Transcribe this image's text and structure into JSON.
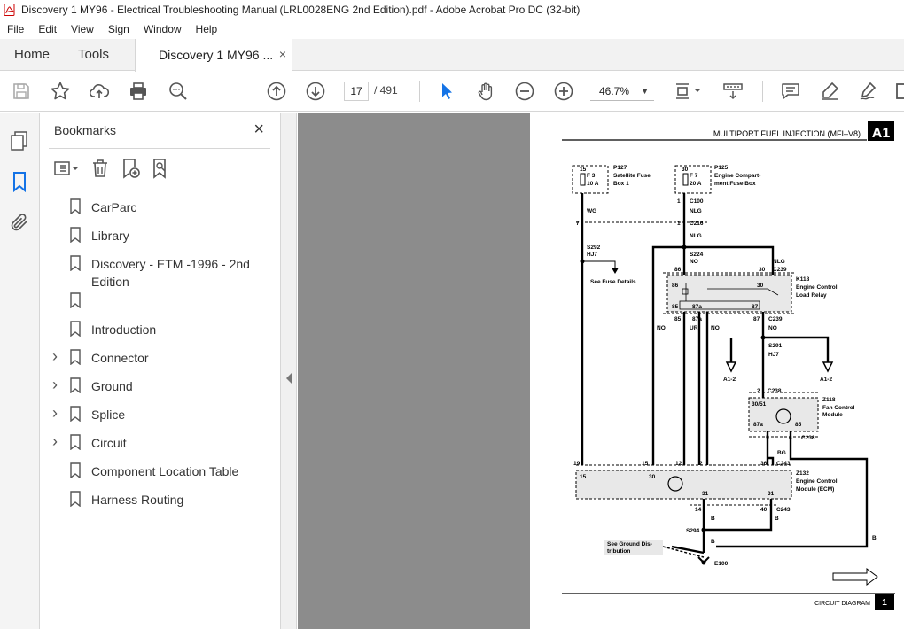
{
  "window": {
    "title": "Discovery 1 MY96 - Electrical Troubleshooting Manual (LRL0028ENG 2nd Edition).pdf - Adobe Acrobat Pro DC (32-bit)"
  },
  "menu": [
    "File",
    "Edit",
    "View",
    "Sign",
    "Window",
    "Help"
  ],
  "tabs": {
    "home": "Home",
    "tools": "Tools",
    "document": "Discovery 1 MY96 ...",
    "close_glyph": "×"
  },
  "toolbar": {
    "current_page": "17",
    "page_total": "/ 491",
    "zoom": "46.7%"
  },
  "bookmarks": {
    "title": "Bookmarks",
    "close_glyph": "×",
    "items": [
      {
        "label": "CarParc",
        "expandable": false
      },
      {
        "label": "Library",
        "expandable": false
      },
      {
        "label": "Discovery - ETM -1996 - 2nd Edition",
        "expandable": false
      },
      {
        "label": "",
        "expandable": false
      },
      {
        "label": "Introduction",
        "expandable": false
      },
      {
        "label": "Connector",
        "expandable": true
      },
      {
        "label": "Ground",
        "expandable": true
      },
      {
        "label": "Splice",
        "expandable": true
      },
      {
        "label": "Circuit",
        "expandable": true
      },
      {
        "label": "Component Location Table",
        "expandable": false
      },
      {
        "label": "Harness Routing",
        "expandable": false
      }
    ]
  },
  "diagram": {
    "header_title": "MULTIPORT FUEL INJECTION (MFI–V8)",
    "header_code": "A1",
    "footer_title": "CIRCUIT DIAGRAM",
    "footer_page": "1",
    "labels": {
      "f3_name": "F 3",
      "f3_rating": "10 A",
      "f3_pin": "15",
      "p127": "P127",
      "p127_desc1": "Satellite Fuse",
      "p127_desc2": "Box 1",
      "f7_name": "F 7",
      "f7_rating": "20 A",
      "f7_pin": "30",
      "p125": "P125",
      "p125_desc1": "Engine Compart-",
      "p125_desc2": "ment Fuse Box",
      "c100": "C100",
      "c216": "C216",
      "nlg": "NLG",
      "wg": "WG",
      "s292": "S292",
      "hj7": "HJ7",
      "see_fuse": "See Fuse Details",
      "s224": "S224",
      "no": "NO",
      "c239": "C239",
      "k118": "K118",
      "k118_desc1": "Engine Control",
      "k118_desc2": "Load Relay",
      "p86": "86",
      "p30": "30",
      "p87": "87",
      "p87a": "87a",
      "p85": "85",
      "ur": "UR",
      "s291": "S291",
      "a12": "A1-2",
      "c238": "C238",
      "z118": "Z118",
      "z118_desc1": "Fan Control",
      "z118_desc2": "Module",
      "p3051": "30/51",
      "bg": "BG",
      "c243": "C243",
      "z132": "Z132",
      "z132_desc1": "Engine Control",
      "z132_desc2": "Module (ECM)",
      "p19": "19",
      "p15": "15",
      "p12": "12",
      "p2": "2",
      "p36": "36",
      "p31": "31",
      "p14": "14",
      "p40": "40",
      "p1": "1",
      "p7": "7",
      "p5": "5",
      "p6": "6",
      "b": "B",
      "s294": "S294",
      "see_ground1": "See Ground Dis-",
      "see_ground2": "tribution",
      "e100": "E100"
    }
  }
}
